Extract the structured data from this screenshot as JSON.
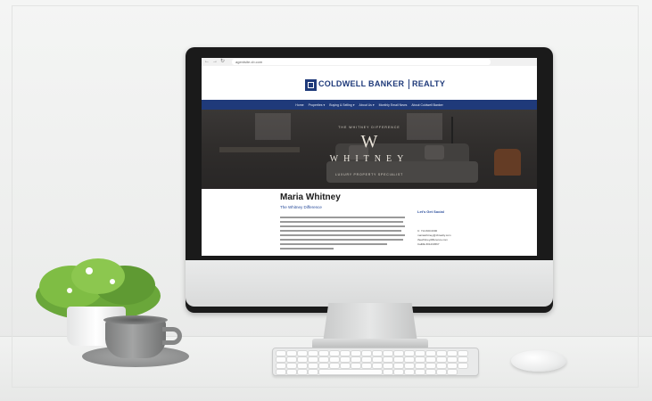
{
  "browser": {
    "back_label": "←",
    "forward_label": "→",
    "reload_label": "↻",
    "url": "agentsite.cb.com"
  },
  "site": {
    "brand": "COLDWELL BANKER",
    "brand_suffix": "REALTY",
    "brand_color": "#1f3a7a",
    "nav": [
      "Home",
      "Properties ▾",
      "Buying & Selling ▾",
      "About Us ▾",
      "Monthly Email News",
      "About Coldwell Banker"
    ]
  },
  "hero": {
    "eyebrow": "THE WHITNEY DIFFERENCE",
    "monogram": "W",
    "name": "WHITNEY",
    "tagline": "LUXURY PROPERTY SPECIALIST"
  },
  "agent": {
    "name": "Maria Whitney",
    "subtitle": "The Whitney Difference"
  },
  "contact": {
    "heading": "Let's Get Social",
    "lines": [
      "C: 714.600.0000",
      "mariawhitney@cbrealty.com",
      "thewhitneydifference.com",
      "CalRE #01234567"
    ]
  }
}
